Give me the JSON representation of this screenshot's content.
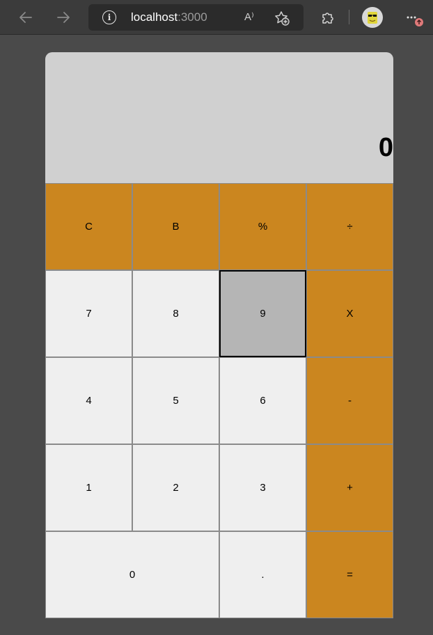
{
  "browser": {
    "url_host": "localhost",
    "url_port": ":3000",
    "read_aloud_glyph": "A⁾"
  },
  "calculator": {
    "display_value": "0",
    "keys": {
      "clear": "C",
      "back": "B",
      "percent": "%",
      "divide": "÷",
      "seven": "7",
      "eight": "8",
      "nine": "9",
      "multiply": "X",
      "four": "4",
      "five": "5",
      "six": "6",
      "minus": "-",
      "one": "1",
      "two": "2",
      "three": "3",
      "plus": "+",
      "zero": "0",
      "decimal": ".",
      "equals": "="
    },
    "colors": {
      "operator": "#cb861f",
      "number": "#efefef",
      "active": "#b5b5b5",
      "display": "#d0d0d0"
    }
  }
}
